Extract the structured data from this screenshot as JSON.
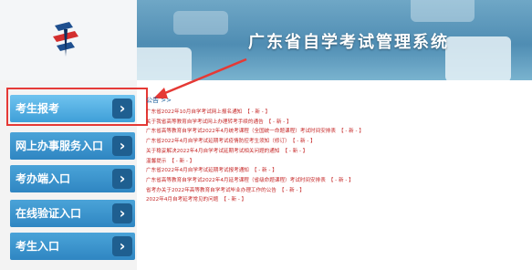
{
  "header": {
    "site_title": "广东省自学考试管理系统"
  },
  "sidebar": {
    "items": [
      {
        "label": "考生报考",
        "arrow": "›"
      },
      {
        "label": "网上办事服务入口",
        "arrow": "›"
      },
      {
        "label": "考办端入口",
        "arrow": "›"
      },
      {
        "label": "在线验证入口",
        "arrow": "›"
      },
      {
        "label": "考生入口",
        "arrow": "›"
      }
    ]
  },
  "notices": {
    "heading": "公告 >>",
    "items": [
      {
        "title": "广东省2022年10月自学考试网上报名通知",
        "badge": "【 - 新 - 】"
      },
      {
        "title": "关于我省高等教育自学考试网上办理转考手续的通告",
        "badge": "【 - 新 - 】"
      },
      {
        "title": "广东省高等教育自学考试2022年4月统考课程（全国统一命题课程）考试时间安排表",
        "badge": "【 - 新 - 】"
      },
      {
        "title": "广东省2022年4月自学考试延期考试疫情防控考生须知（修订）",
        "badge": "【 - 新 - 】"
      },
      {
        "title": "关于稳妥解决2022年4月自学考试延期考试相关问题的通知",
        "badge": "【 - 新 - 】"
      },
      {
        "title": "温馨提示",
        "badge": "【 - 新 - 】"
      },
      {
        "title": "广东省2022年4月自学考试延期考试报考通知",
        "badge": "【 - 新 - 】"
      },
      {
        "title": "广东省高等教育自学考试2022年4月延考课程（省级命题课程）考试时间安排表",
        "badge": "【 - 新 - 】"
      },
      {
        "title": "省考办关于2022年高等教育自学考试毕业办理工作的公告",
        "badge": "【 - 新 - 】"
      },
      {
        "title": "2022年4月自考延考常见的问题",
        "badge": "【 - 新 - 】"
      }
    ]
  },
  "colors": {
    "nav_blue": "#2f86c2",
    "notice_red": "#c62828",
    "annotation_red": "#e53935"
  }
}
